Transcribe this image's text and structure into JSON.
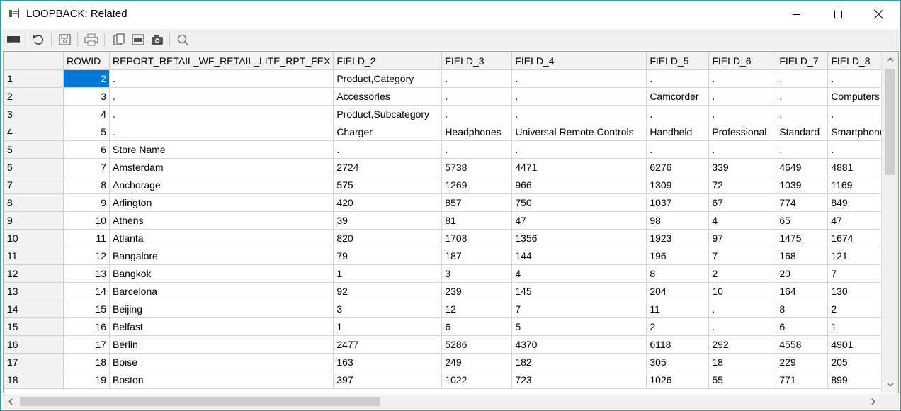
{
  "window": {
    "title": "LOOPBACK: Related"
  },
  "toolbar": {
    "buttons": [
      {
        "icon": "grid-view-icon"
      },
      {
        "icon": "undo-icon"
      },
      {
        "icon": "save-icon"
      },
      {
        "icon": "print-icon"
      },
      {
        "icon": "copy-icon"
      },
      {
        "icon": "export-icon"
      },
      {
        "icon": "camera-icon"
      },
      {
        "icon": "search-icon"
      }
    ]
  },
  "grid": {
    "columns": [
      "",
      "ROWID",
      "REPORT_RETAIL_WF_RETAIL_LITE_RPT_FEX",
      "FIELD_2",
      "FIELD_3",
      "FIELD_4",
      "FIELD_5",
      "FIELD_6",
      "FIELD_7",
      "FIELD_8"
    ],
    "rows": [
      [
        "1",
        "2",
        ".",
        "Product,Category",
        ".",
        ".",
        ".",
        ".",
        ".",
        "."
      ],
      [
        "2",
        "3",
        ".",
        "Accessories",
        ".",
        ".",
        "Camcorder",
        ".",
        ".",
        "Computers"
      ],
      [
        "3",
        "4",
        ".",
        "Product,Subcategory",
        ".",
        ".",
        ".",
        ".",
        ".",
        "."
      ],
      [
        "4",
        "5",
        ".",
        "Charger",
        "Headphones",
        "Universal Remote Controls",
        "Handheld",
        "Professional",
        "Standard",
        "Smartphone"
      ],
      [
        "5",
        "6",
        "Store Name",
        ".",
        ".",
        ".",
        ".",
        ".",
        ".",
        "."
      ],
      [
        "6",
        "7",
        "Amsterdam",
        "2724",
        "5738",
        "4471",
        "6276",
        "339",
        "4649",
        "4881"
      ],
      [
        "7",
        "8",
        "Anchorage",
        "575",
        "1269",
        "966",
        "1309",
        "72",
        "1039",
        "1169"
      ],
      [
        "8",
        "9",
        "Arlington",
        "420",
        "857",
        "750",
        "1037",
        "67",
        "774",
        "849"
      ],
      [
        "9",
        "10",
        "Athens",
        "39",
        "81",
        "47",
        "98",
        "4",
        "65",
        "47"
      ],
      [
        "10",
        "11",
        "Atlanta",
        "820",
        "1708",
        "1356",
        "1923",
        "97",
        "1475",
        "1674"
      ],
      [
        "11",
        "12",
        "Bangalore",
        "79",
        "187",
        "144",
        "196",
        "7",
        "168",
        "121"
      ],
      [
        "12",
        "13",
        "Bangkok",
        "1",
        "3",
        "4",
        "8",
        "2",
        "20",
        "7"
      ],
      [
        "13",
        "14",
        "Barcelona",
        "92",
        "239",
        "145",
        "204",
        "10",
        "164",
        "130"
      ],
      [
        "14",
        "15",
        "Beijing",
        "3",
        "12",
        "7",
        "11",
        ".",
        "8",
        "2"
      ],
      [
        "15",
        "16",
        "Belfast",
        "1",
        "6",
        "5",
        "2",
        ".",
        "6",
        "1"
      ],
      [
        "16",
        "17",
        "Berlin",
        "2477",
        "5286",
        "4370",
        "6118",
        "292",
        "4558",
        "4901"
      ],
      [
        "17",
        "18",
        "Boise",
        "163",
        "249",
        "182",
        "305",
        "18",
        "229",
        "205"
      ],
      [
        "18",
        "19",
        "Boston",
        "397",
        "1022",
        "723",
        "1026",
        "55",
        "771",
        "899"
      ]
    ]
  }
}
